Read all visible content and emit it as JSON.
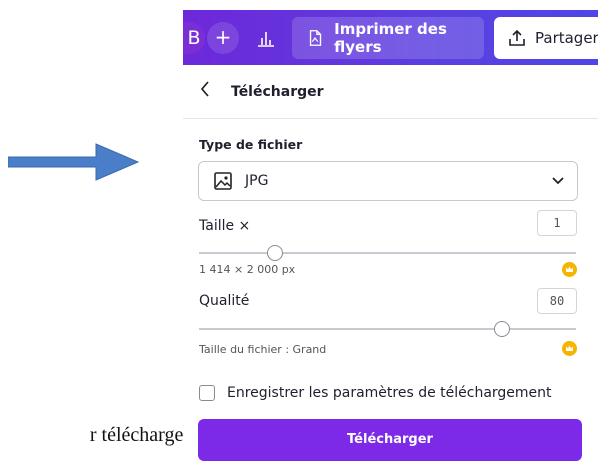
{
  "topbar": {
    "avatar_letter": "B",
    "plus_label": "+",
    "flyer_button_label": "Imprimer des flyers",
    "share_button_label": "Partager"
  },
  "panel": {
    "back_icon": "chevron-left-icon",
    "title": "Télécharger",
    "file_type_label": "Type de fichier",
    "file_type_value": "JPG",
    "size_label": "Taille ×",
    "size_value": "1",
    "size_slider_fraction": 0.2,
    "dimensions_text": "1 414 × 2 000 px",
    "quality_label": "Qualité",
    "quality_value": "80",
    "quality_slider_fraction": 0.8,
    "file_size_text": "Taille du fichier : Grand",
    "save_settings_label": "Enregistrer les paramètres de téléchargement",
    "save_settings_checked": false,
    "download_button_label": "Télécharger"
  },
  "background": {
    "partial_text": "r télécharger"
  },
  "colors": {
    "accent_purple": "#7d2ae8",
    "topbar_gradient_start": "#6d28d9",
    "arrow_blue": "#4a7ec8",
    "crown_gold": "#f4b400"
  }
}
